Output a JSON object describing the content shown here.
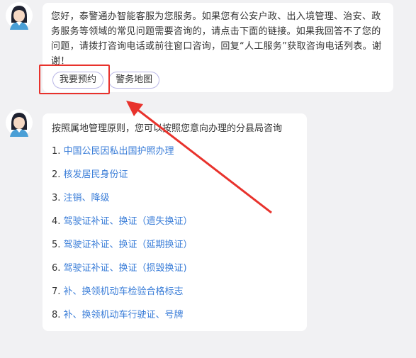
{
  "greeting": {
    "text": "您好，泰警通办智能客服为您服务。如果您有公安户政、出入境管理、治安、政务服务等领域的常见问题需要咨询的，请点击下面的链接。如果我回答不了您的问题，请拨打咨询电话或前往窗口咨询，回复“人工服务”获取咨询电话列表。谢谢！",
    "buttons": [
      "我要预约",
      "警务地图"
    ]
  },
  "response": {
    "intro": "按照属地管理原则，您可以按照您意向办理的分县局咨询",
    "items": [
      {
        "num": "1.",
        "label": "中国公民因私出国护照办理"
      },
      {
        "num": "2.",
        "label": "核发居民身份证"
      },
      {
        "num": "3.",
        "label": "注销、降级"
      },
      {
        "num": "4.",
        "label": "驾驶证补证、换证（遗失换证）"
      },
      {
        "num": "5.",
        "label": "驾驶证补证、换证（延期换证）"
      },
      {
        "num": "6.",
        "label": "驾驶证补证、换证（损毁换证)"
      },
      {
        "num": "7.",
        "label": "补、换领机动车检验合格标志"
      },
      {
        "num": "8.",
        "label": "补、换领机动车行驶证、号牌"
      }
    ]
  },
  "colors": {
    "annotation": "#e8322c",
    "link": "#3a7dd8",
    "pill_border": "#b9b6e6"
  },
  "icons": [
    "agent-avatar-icon",
    "annotation-arrow-icon"
  ]
}
